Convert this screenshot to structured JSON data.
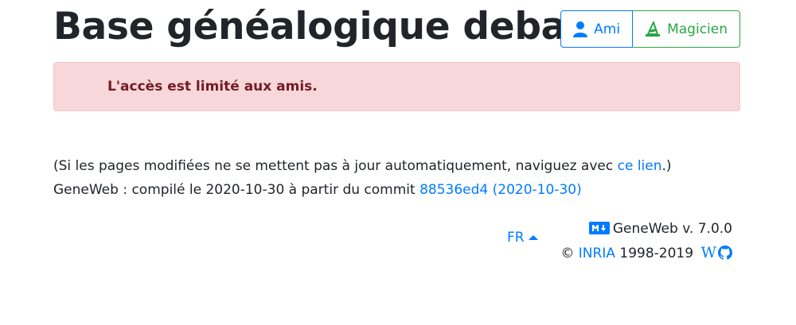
{
  "header": {
    "title": "Base généalogique debast",
    "buttons": {
      "ami_label": "Ami",
      "magicien_label": "Magicien"
    }
  },
  "alert": {
    "message": "L'accès est limité aux amis."
  },
  "info": {
    "line1_prefix": "(Si les pages modifiées ne se mettent pas à jour automatiquement, naviguez avec ",
    "line1_link": "ce lien",
    "line1_suffix": ".)",
    "line2_prefix": "GeneWeb : compilé le 2020-10-30 à partir du commit ",
    "line2_link": "88536ed4 (2020-10-30)"
  },
  "footer": {
    "lang": "FR",
    "version": "GeneWeb v. 7.0.0",
    "copyright_symbol": "©",
    "org_link": "INRIA",
    "years": "1998-2019",
    "wiki_letter": "W"
  },
  "colors": {
    "primary": "#007bff",
    "success": "#28a745",
    "danger_bg": "#f8d7da",
    "danger_text": "#721c24"
  },
  "icons": {
    "ami": "user-icon",
    "magicien": "wizard-hat-icon",
    "markdown": "markdown-icon",
    "wiki": "wikipedia-icon",
    "github": "github-icon",
    "lang_caret": "caret-up-icon"
  }
}
